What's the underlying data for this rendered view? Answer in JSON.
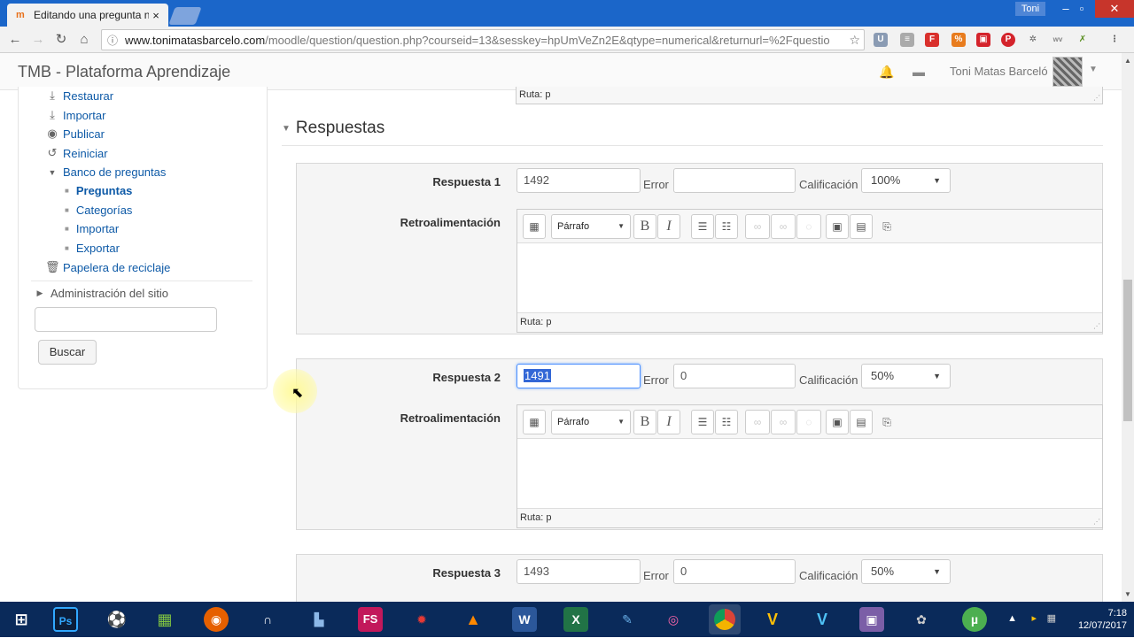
{
  "browser": {
    "tab_title": "Editando una pregunta n",
    "tab_close": "×",
    "user_chip": "Toni",
    "url_host": "www.tonimatasbarcelo.com",
    "url_path": "/moodle/question/question.php?courseid=13&sesskey=hpUmVeZn2E&qtype=numerical&returnurl=%2Fquestio"
  },
  "header": {
    "brand": "TMB - Plataforma Aprendizaje",
    "user_name": "Toni Matas Barceló"
  },
  "sidebar": {
    "items": [
      {
        "label": "Restaurar",
        "icon": "restore-icon"
      },
      {
        "label": "Importar",
        "icon": "import-icon"
      },
      {
        "label": "Publicar",
        "icon": "publish-icon"
      },
      {
        "label": "Reiniciar",
        "icon": "reset-icon"
      },
      {
        "label": "Banco de preguntas",
        "icon": "expanded-arrow-icon"
      },
      {
        "label": "Preguntas"
      },
      {
        "label": "Categorías"
      },
      {
        "label": "Importar"
      },
      {
        "label": "Exportar"
      },
      {
        "label": "Papelera de reciclaje",
        "icon": "trash-icon"
      },
      {
        "label": "Administración del sitio",
        "icon": "collapsed-arrow-icon"
      }
    ],
    "search_button": "Buscar"
  },
  "main": {
    "prev_path": "Ruta: p",
    "section_title": "Respuestas",
    "answers": [
      {
        "label": "Respuesta 1",
        "value": "1492",
        "error_label": "Error",
        "error_value": "",
        "grade_label": "Calificación",
        "grade": "100%",
        "feedback_label": "Retroalimentación",
        "format": "Párrafo",
        "path": "Ruta: p"
      },
      {
        "label": "Respuesta 2",
        "value": "1491",
        "error_label": "Error",
        "error_value": "0",
        "grade_label": "Calificación",
        "grade": "50%",
        "feedback_label": "Retroalimentación",
        "format": "Párrafo",
        "path": "Ruta: p"
      },
      {
        "label": "Respuesta 3",
        "value": "1493",
        "error_label": "Error",
        "error_value": "0",
        "grade_label": "Calificación",
        "grade": "50%"
      }
    ]
  },
  "taskbar": {
    "clock_time": "7:18",
    "clock_date": "12/07/2017",
    "apps": [
      "Ps",
      "FS"
    ]
  }
}
